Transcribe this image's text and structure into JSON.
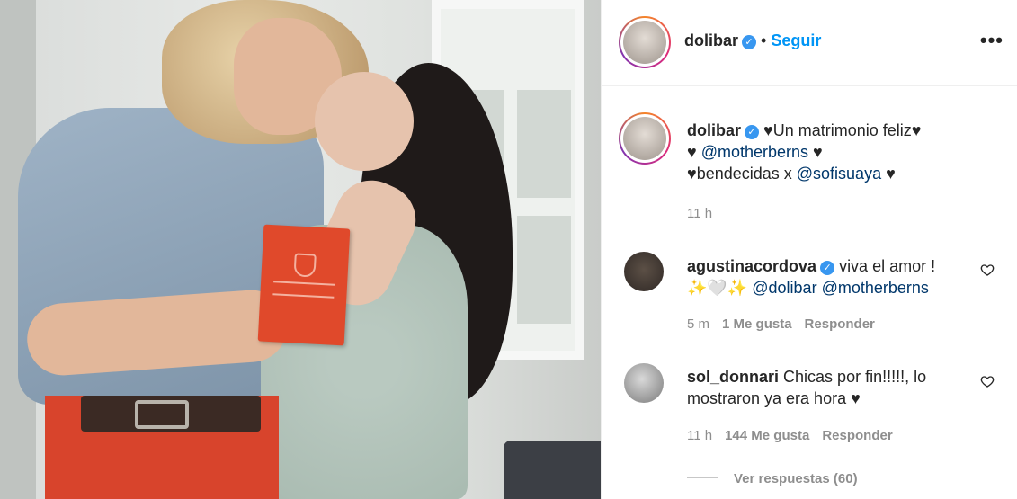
{
  "post": {
    "author": "dolibar",
    "follow_label": "Seguir",
    "separator": "•",
    "more_label": "•••"
  },
  "caption": {
    "author": "dolibar",
    "line1_text": "♥Un matrimonio feliz♥",
    "line2_pre": "♥ ",
    "line2_mention": "@motherberns",
    "line2_post": " ♥",
    "line3_pre": "♥bendecidas x ",
    "line3_mention": "@sofisuaya",
    "line3_post": " ♥",
    "time": "11 h"
  },
  "comments": [
    {
      "author": "agustinacordova",
      "verified": true,
      "text_line1": "viva el amor !",
      "text_line2_pre": "✨🤍✨ ",
      "mention1": "@dolibar",
      "mention2": "@motherberns",
      "time": "5 m",
      "likes": "1 Me gusta",
      "reply_label": "Responder"
    },
    {
      "author": "sol_donnari",
      "verified": false,
      "text_line1": "Chicas por fin!!!!!, lo",
      "text_line2": "mostraron ya era hora ♥",
      "time": "11 h",
      "likes": "144 Me gusta",
      "reply_label": "Responder",
      "view_replies": "Ver respuestas (60)"
    }
  ],
  "colors": {
    "link": "#0095f6",
    "mention": "#00376b",
    "meta": "#8e8e8e",
    "verified": "#3897f0"
  },
  "icons": [
    "verified-badge-icon",
    "heart-outline-icon",
    "more-options-icon"
  ]
}
